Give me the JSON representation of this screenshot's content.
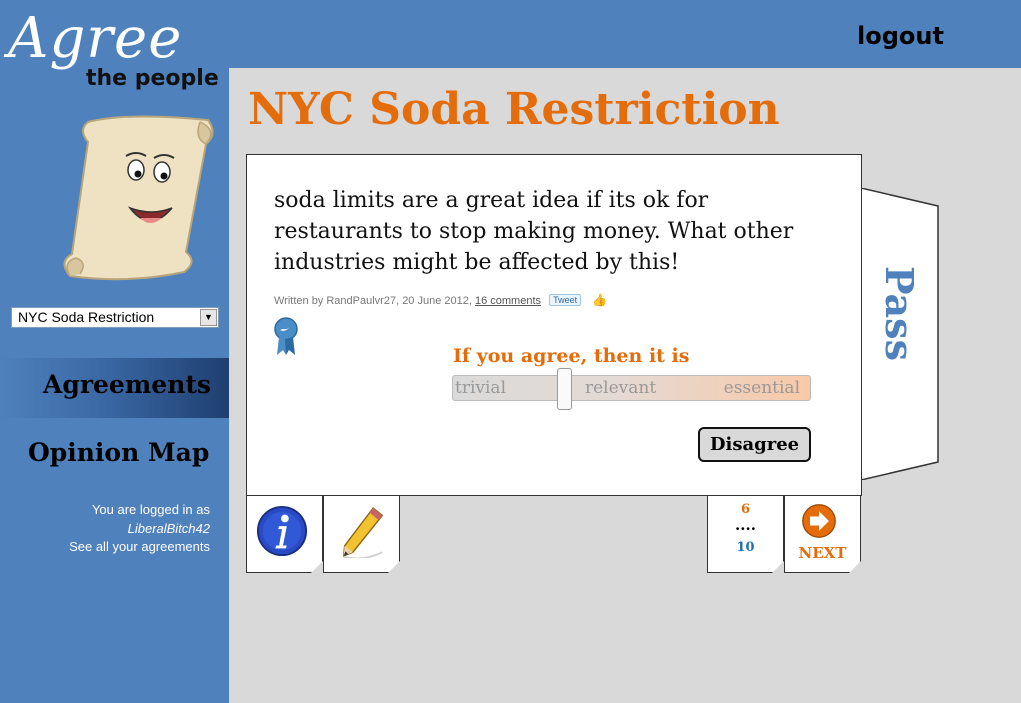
{
  "brand": {
    "logo_script": "Agree",
    "logo_sub": "the people"
  },
  "header": {
    "logout_label": "logout"
  },
  "sidebar": {
    "select_value": "NYC Soda Restriction",
    "nav": {
      "agreements": "Agreements",
      "opinion_map": "Opinion Map"
    },
    "login": {
      "prefix": "You are logged in as",
      "username": "LiberalBitch42",
      "see_all": "See all your agreements"
    }
  },
  "main": {
    "title": "NYC Soda Restriction",
    "statement": "soda limits are a great idea if its ok for restaurants to stop making money. What other industries might be affected by this!",
    "meta": {
      "written_by": "Written by RandPaulvr27, 20 June 2012,",
      "comments": "16 comments",
      "tweet": "Tweet"
    },
    "prompt": "If you agree, then it is",
    "scale": {
      "low": "trivial",
      "mid": "relevant",
      "high": "essential",
      "value_fraction": 0.31
    },
    "disagree_label": "Disagree",
    "pass_label": "Pass",
    "counter": {
      "current": "6",
      "separator": "....",
      "total": "10"
    },
    "next_label": "NEXT"
  },
  "colors": {
    "blue": "#4f81bd",
    "orange": "#e46c0a",
    "background": "#d9d9d9"
  },
  "icons": [
    "scroll-mascot",
    "twitter-ribbon-icon",
    "info-icon",
    "pencil-icon",
    "next-arrow-icon",
    "like-icon",
    "dropdown-arrow-icon"
  ]
}
